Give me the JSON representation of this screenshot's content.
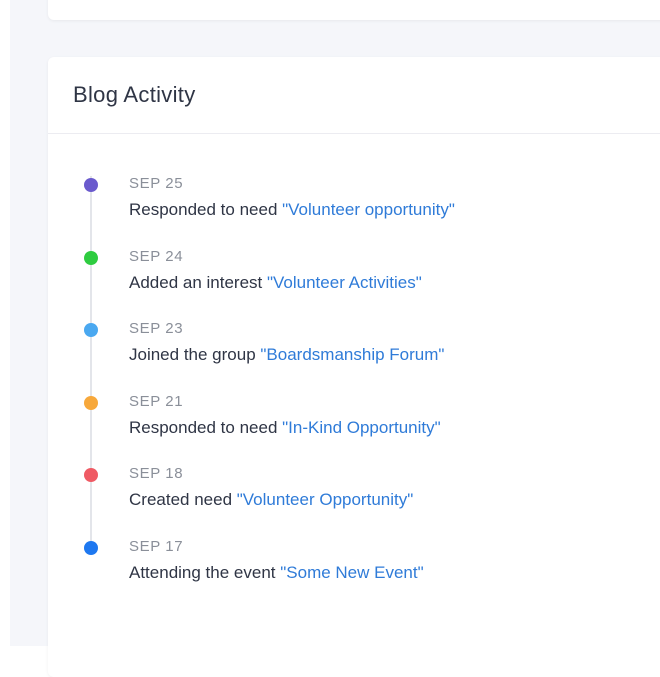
{
  "card": {
    "title": "Blog Activity"
  },
  "activity": [
    {
      "date": "SEP 25",
      "action": "Responded to need ",
      "link": "\"Volunteer opportunity\"",
      "color": "#6a5acd"
    },
    {
      "date": "SEP 24",
      "action": "Added an interest ",
      "link": "\"Volunteer Activities\"",
      "color": "#2ecc40"
    },
    {
      "date": "SEP 23",
      "action": "Joined the group ",
      "link": "\"Boardsmanship Forum\"",
      "color": "#4aa8f0"
    },
    {
      "date": "SEP 21",
      "action": "Responded to need ",
      "link": "\"In-Kind Opportunity\"",
      "color": "#f7a83b"
    },
    {
      "date": "SEP 18",
      "action": "Created need ",
      "link": "\"Volunteer Opportunity\"",
      "color": "#ef5a64"
    },
    {
      "date": "SEP 17",
      "action": "Attending the event ",
      "link": "\"Some New Event\"",
      "color": "#1e78f0"
    }
  ]
}
